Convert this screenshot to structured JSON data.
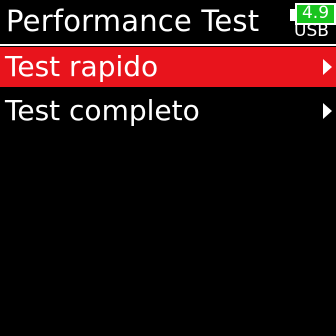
{
  "header": {
    "title": "Performance Test",
    "battery": {
      "voltage": "4.9",
      "source": "USB",
      "level": 1.0,
      "fill_color": "#19c41f"
    }
  },
  "menu": {
    "selected_color": "#e8141c",
    "items": [
      {
        "label": "Test rapido",
        "selected": true,
        "icon": "chevron-right-icon"
      },
      {
        "label": "Test completo",
        "selected": false,
        "icon": "chevron-right-icon"
      }
    ]
  }
}
